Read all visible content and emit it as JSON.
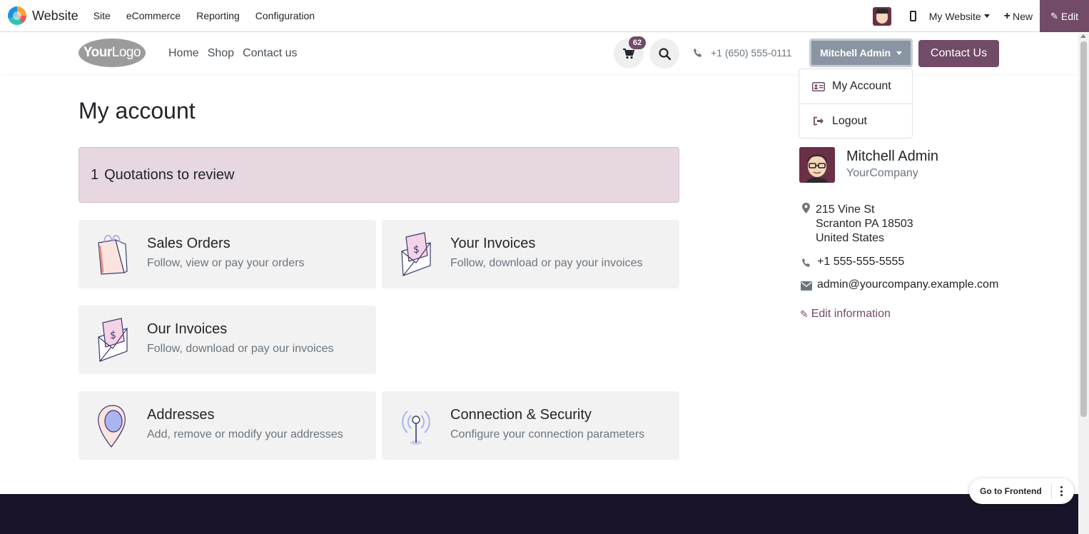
{
  "admin_bar": {
    "app_name": "Website",
    "menu": [
      "Site",
      "eCommerce",
      "Reporting",
      "Configuration"
    ],
    "website_switcher": "My Website",
    "new_label": "New",
    "edit_label": "Edit"
  },
  "site_header": {
    "logo_text_bold": "Your",
    "logo_text": "Logo",
    "nav": [
      "Home",
      "Shop",
      "Contact us"
    ],
    "cart_count": "62",
    "phone": "+1 (650) 555-0111",
    "user_menu_label": "Mitchell Admin",
    "contact_button": "Contact Us",
    "user_dropdown": [
      {
        "label": "My Account",
        "icon": "id-card-icon"
      },
      {
        "label": "Logout",
        "icon": "sign-out-icon"
      }
    ]
  },
  "main": {
    "title": "My account",
    "alert": {
      "count": "1",
      "text": "Quotations to review"
    },
    "cards": [
      {
        "title": "Sales Orders",
        "subtitle": "Follow, view or pay your orders",
        "icon": "shopping-bag-icon"
      },
      {
        "title": "Your Invoices",
        "subtitle": "Follow, download or pay your invoices",
        "icon": "invoice-envelope-icon"
      },
      {
        "title": "Our Invoices",
        "subtitle": "Follow, download or pay our invoices",
        "icon": "invoice-envelope-icon"
      },
      {
        "title": "Addresses",
        "subtitle": "Add, remove or modify your addresses",
        "icon": "map-pin-icon"
      },
      {
        "title": "Connection & Security",
        "subtitle": "Configure your connection parameters",
        "icon": "antenna-icon"
      }
    ]
  },
  "profile": {
    "name": "Mitchell Admin",
    "company": "YourCompany",
    "address_lines": [
      "215 Vine St",
      "Scranton PA 18503",
      "United States"
    ],
    "phone": "+1 555-555-5555",
    "email": "admin@yourcompany.example.com",
    "edit_label": "Edit information"
  },
  "floating": {
    "goto_frontend": "Go to Frontend"
  },
  "colors": {
    "primary": "#714b67",
    "alert_bg": "#e6d7e1",
    "card_bg": "#f2f2f2",
    "footer": "#1a1429"
  }
}
